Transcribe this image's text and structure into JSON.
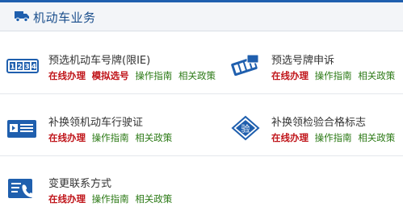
{
  "header": {
    "title": "机动车业务",
    "icon": "truck-icon"
  },
  "colors": {
    "accent": "#1f5fae",
    "online": "#c0161b",
    "guide": "#2c7a16"
  },
  "services": {
    "s1": {
      "name": "预选机动车号牌(限IE)",
      "icon": "number-plate-icon",
      "links": {
        "online": "在线办理",
        "simulate": "模拟选号",
        "guide": "操作指南",
        "policy": "相关政策"
      }
    },
    "s2": {
      "name": "预选号牌申诉",
      "icon": "appeal-cards-icon",
      "links": {
        "online": "在线办理",
        "guide": "操作指南",
        "policy": "相关政策"
      }
    },
    "s3": {
      "name": "补换领机动车行驶证",
      "icon": "license-card-icon",
      "links": {
        "online": "在线办理",
        "guide": "操作指南",
        "policy": "相关政策"
      }
    },
    "s4": {
      "name": "补换领检验合格标志",
      "icon": "inspection-badge-icon",
      "badge_text": "验",
      "links": {
        "online": "在线办理",
        "guide": "操作指南",
        "policy": "相关政策"
      }
    },
    "s5": {
      "name": "变更联系方式",
      "icon": "contact-phone-icon",
      "links": {
        "online": "在线办理",
        "guide": "操作指南",
        "policy": "相关政策"
      }
    }
  }
}
